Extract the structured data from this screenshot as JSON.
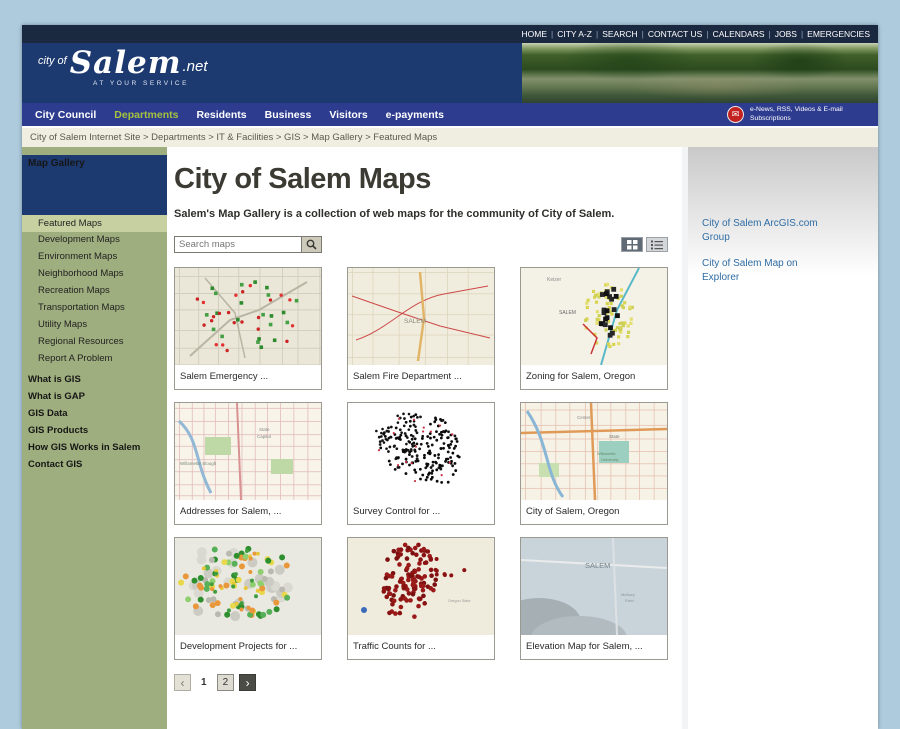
{
  "topbar": {
    "links": [
      "HOME",
      "CITY A-Z",
      "SEARCH",
      "CONTACT US",
      "CALENDARS",
      "JOBS",
      "EMERGENCIES"
    ]
  },
  "header": {
    "logo_prefix": "city of",
    "logo_main": "Salem",
    "logo_suffix": ".net",
    "tagline": "AT YOUR SERVICE"
  },
  "nav": {
    "items": [
      {
        "label": "City Council"
      },
      {
        "label": "Departments"
      },
      {
        "label": "Residents"
      },
      {
        "label": "Business"
      },
      {
        "label": "Visitors"
      },
      {
        "label": "e-payments"
      }
    ],
    "subscriptions": "e-News, RSS, Videos & E-mail Subscriptions"
  },
  "icons": {
    "envelope": "✉",
    "prev": "‹",
    "next": "›"
  },
  "breadcrumb": {
    "trail": "City of Salem Internet Site > Departments > IT & Facilities > GIS > Map Gallery > Featured Maps"
  },
  "sidebar": {
    "items": [
      {
        "label": "Map Gallery"
      },
      {
        "label": "Featured Maps"
      },
      {
        "label": "Development Maps"
      },
      {
        "label": "Environment Maps"
      },
      {
        "label": "Neighborhood Maps"
      },
      {
        "label": "Recreation Maps"
      },
      {
        "label": "Transportation Maps"
      },
      {
        "label": "Utility Maps"
      },
      {
        "label": "Regional Resources"
      },
      {
        "label": "Report A Problem"
      },
      {
        "label": "What is GIS"
      },
      {
        "label": "What is GAP"
      },
      {
        "label": "GIS Data"
      },
      {
        "label": "GIS Products"
      },
      {
        "label": "How GIS Works in Salem"
      },
      {
        "label": "Contact GIS"
      }
    ]
  },
  "main": {
    "title": "City of Salem Maps",
    "intro": "Salem's Map Gallery is a collection of web maps for the community of City of Salem.",
    "search_placeholder": "Search maps",
    "cards": [
      {
        "label": "Salem Emergency ...",
        "thumb": "emergency",
        "map_labels": []
      },
      {
        "label": "Salem Fire Department ...",
        "thumb": "fire",
        "map_labels": [
          "SALEM"
        ]
      },
      {
        "label": "Zoning for Salem, Oregon",
        "thumb": "zoning",
        "map_labels": [
          "Keizer",
          "SALEM"
        ]
      },
      {
        "label": "Addresses for Salem, ...",
        "thumb": "addresses",
        "map_labels": [
          "Willamette Slough",
          "State",
          "Capitol"
        ]
      },
      {
        "label": "Survey Control for ...",
        "thumb": "survey",
        "map_labels": []
      },
      {
        "label": "City of Salem, Oregon",
        "thumb": "cityofsalem",
        "map_labels": [
          "Center",
          "State",
          "Willamette",
          "University"
        ]
      },
      {
        "label": "Development Projects for ...",
        "thumb": "development",
        "map_labels": []
      },
      {
        "label": "Traffic Counts for ...",
        "thumb": "traffic",
        "map_labels": [
          "Oregon State"
        ]
      },
      {
        "label": "Elevation Map for Salem, ...",
        "thumb": "elevation",
        "map_labels": [
          "SALEM",
          "McNary",
          "Field"
        ]
      }
    ],
    "pagination": {
      "pages": [
        "1",
        "2"
      ]
    }
  },
  "rightbar": {
    "links": [
      "City of Salem ArcGIS.com Group",
      "City of Salem Map on Explorer"
    ]
  },
  "colors": {
    "outer_background": "#aecbdd",
    "topbar": "#1b2940",
    "header_blue": "#1d3a70",
    "nav_blue": "#2d3c8f",
    "nav_active_green": "#a6c23e",
    "sidebar_olive": "#9fae7e",
    "sidebar_selected": "#c6d0a0",
    "breadcrumb_bg": "#efeee0",
    "link_blue": "#2f6da5",
    "alert_red": "#c32222"
  }
}
